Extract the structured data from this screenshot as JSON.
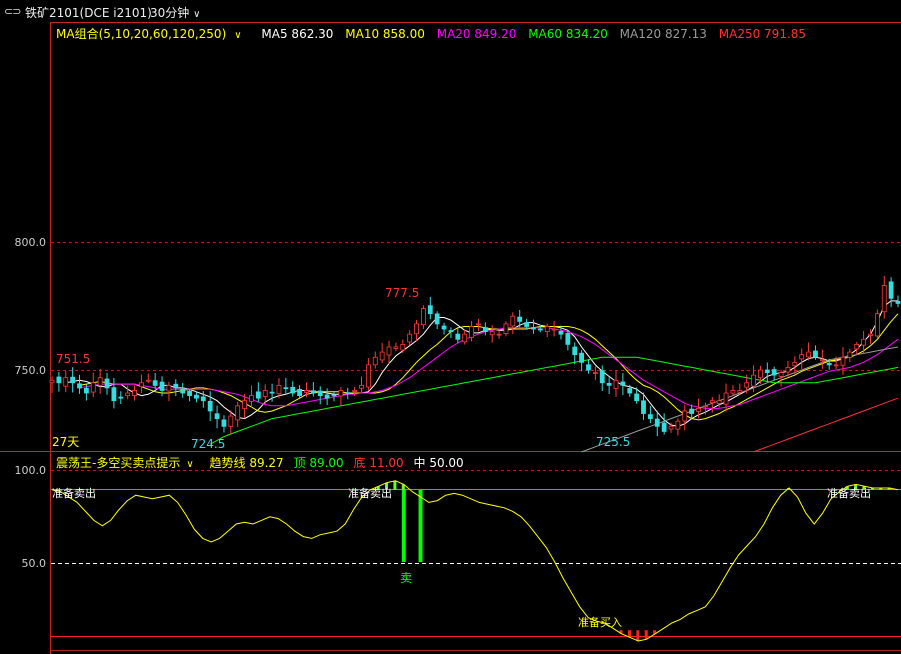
{
  "header": {
    "symbol": "铁矿2101(DCE i2101)",
    "period": "30分钟",
    "icon": "link-icon",
    "dropdown_icon": "chevron-down-icon"
  },
  "ma_legend": {
    "group_label": "MA组合(5,10,20,60,120,250)",
    "items": [
      {
        "label": "MA5 862.30",
        "color": "#ffffff"
      },
      {
        "label": "MA10 858.00",
        "color": "#ffff00"
      },
      {
        "label": "MA20 849.20",
        "color": "#ff00ff"
      },
      {
        "label": "MA60 834.20",
        "color": "#00ff00"
      },
      {
        "label": "MA120 827.13",
        "color": "#9a9a9a"
      },
      {
        "label": "MA250 791.85",
        "color": "#ff3333"
      }
    ]
  },
  "osc_legend": {
    "name": "震荡王-多空买卖点提示",
    "items": [
      {
        "label": "趋势线 89.27",
        "color": "#ffff00"
      },
      {
        "label": "顶 89.00",
        "color": "#00ff00"
      },
      {
        "label": "底 11.00",
        "color": "#ff3333"
      },
      {
        "label": "中 50.00",
        "color": "#ffffff"
      }
    ]
  },
  "chart_data": [
    {
      "type": "candlestick",
      "y_ticks": [
        "800.0",
        "750.0"
      ],
      "ylim": [
        718,
        856
      ],
      "annotations": [
        {
          "text": "751.5",
          "color": "#ff3333"
        },
        {
          "text": "724.5",
          "color": "#33dddd"
        },
        {
          "text": "777.5",
          "color": "#ff3333"
        },
        {
          "text": "725.5",
          "color": "#33dddd"
        },
        {
          "text": "27天",
          "color": "#ffff00"
        }
      ],
      "close": [
        746,
        745,
        747,
        745,
        743,
        741,
        745,
        747,
        743,
        738,
        739,
        741,
        742,
        745,
        746,
        744,
        742,
        744,
        743,
        741,
        740,
        739,
        738,
        734,
        731,
        728,
        732,
        736,
        738,
        740,
        739,
        742,
        741,
        744,
        743,
        741,
        740,
        742,
        741,
        740,
        739,
        740,
        742,
        741,
        742,
        744,
        752,
        755,
        757,
        759,
        759,
        760,
        764,
        768,
        774,
        772,
        768,
        766,
        765,
        762,
        764,
        767,
        768,
        765,
        765,
        764,
        768,
        771,
        769,
        767,
        766,
        766,
        767,
        766,
        764,
        760,
        756,
        753,
        750,
        749,
        745,
        744,
        746,
        744,
        741,
        738,
        733,
        731,
        728,
        726,
        728,
        730,
        734,
        733,
        735,
        736,
        738,
        738,
        741,
        742,
        742,
        745,
        748,
        750,
        749,
        748,
        749,
        751,
        753,
        756,
        757,
        755,
        754,
        752,
        752,
        755,
        757,
        760,
        762,
        764,
        772,
        783,
        778,
        776
      ],
      "ma_series": [
        {
          "name": "MA5",
          "color": "#ffffff",
          "values": [
            745,
            745.5,
            746,
            745.5,
            744.5,
            743.5,
            743.5,
            744.5,
            744.5,
            742.5,
            741,
            740,
            740.5,
            742,
            744,
            744,
            743,
            743,
            742.5,
            741.5,
            740.5,
            739.5,
            738,
            735.5,
            733.5,
            731.5,
            731,
            732.5,
            734.5,
            737.5,
            739,
            740,
            740.5,
            741.5,
            742,
            742,
            741.5,
            741.5,
            741,
            740.5,
            740.5,
            740.5,
            741,
            741,
            741.5,
            744.5,
            749,
            752.5,
            755.5,
            757.5,
            759.5,
            761.5,
            764,
            767.5,
            770.5,
            770.5,
            769.5,
            767.5,
            765.5,
            764.5,
            764.5,
            765.5,
            766,
            765.5,
            765.5,
            766,
            767.5,
            768.5,
            768.5,
            767.5,
            767,
            767,
            766.5,
            765.5,
            763,
            759,
            755.5,
            752,
            749.5,
            747.5,
            745.5,
            744,
            743.5,
            742.5,
            740.5,
            737,
            733.5,
            730.5,
            728.5,
            728,
            729,
            731,
            732.5,
            733.5,
            735,
            736.5,
            737.5,
            739,
            740.5,
            742,
            743.5,
            745.5,
            747.5,
            748.5,
            749,
            749.5,
            751,
            753,
            754.5,
            755,
            754.5,
            753.5,
            753.5,
            754.5,
            756,
            758,
            761,
            764,
            769,
            775,
            777,
            777
          ]
        },
        {
          "name": "MA10",
          "color": "#ffff00",
          "values": [
            744,
            744.5,
            745,
            745.5,
            745,
            744.5,
            744.5,
            744.5,
            744.5,
            743.5,
            742.5,
            741.5,
            741,
            741,
            741.5,
            742,
            742.5,
            743,
            743,
            742.5,
            742,
            741,
            740,
            738.5,
            737,
            735.5,
            734,
            733.5,
            734,
            735,
            736,
            737.5,
            739,
            740.5,
            741,
            741.5,
            741.5,
            741.5,
            741.5,
            741,
            741,
            741,
            741,
            741,
            741.5,
            742.5,
            744.5,
            747,
            750,
            753,
            755.5,
            758,
            760,
            762.5,
            765,
            766.5,
            767,
            767,
            767,
            766.5,
            766,
            766,
            766,
            766,
            766,
            766,
            766.5,
            767,
            767,
            767,
            767,
            767,
            766.5,
            765.5,
            764,
            762,
            759.5,
            757,
            754.5,
            751.5,
            748.5,
            746,
            744,
            743,
            741.5,
            739.5,
            737,
            734.5,
            732.5,
            731,
            730.5,
            731,
            732,
            733,
            734.5,
            735.5,
            737,
            738.5,
            740,
            741.5,
            743,
            744.5,
            746,
            747,
            748,
            749.5,
            750.5,
            751.5,
            752.5,
            753.5,
            754,
            754.5,
            755,
            756,
            757.5,
            759.5,
            762,
            765.5,
            769,
            772
          ]
        },
        {
          "name": "MA20",
          "color": "#ff00ff",
          "values": [
            743,
            743.5,
            744,
            744.5,
            744.5,
            744.5,
            744.5,
            744.5,
            744.5,
            744,
            743.5,
            743,
            742.5,
            742.5,
            742.5,
            742.5,
            742.5,
            742.5,
            742.5,
            742.5,
            742,
            741.5,
            741,
            740.5,
            739.5,
            738.5,
            737.5,
            736.5,
            736,
            736,
            736,
            736.5,
            737,
            737.5,
            738,
            738.5,
            739,
            739.5,
            740,
            740.5,
            740.5,
            741,
            741,
            741.5,
            742,
            743,
            744,
            745.5,
            747,
            749,
            751,
            753,
            755,
            757,
            759,
            760.5,
            762,
            763,
            764,
            765,
            765.5,
            766,
            766.5,
            766.5,
            766.5,
            766.5,
            766.5,
            766.5,
            766.5,
            766,
            765.5,
            765,
            764,
            763,
            761.5,
            760,
            758,
            756,
            754,
            752,
            750,
            748,
            746,
            744.5,
            743,
            741.5,
            740,
            738.5,
            737,
            736,
            735.5,
            735,
            735,
            735,
            735.5,
            736,
            736.5,
            737.5,
            738.5,
            739.5,
            740.5,
            741.5,
            742.5,
            743.5,
            744.5,
            745.5,
            746.5,
            747.5,
            748.5,
            749.5,
            750,
            750.5,
            751,
            752,
            753,
            754.5,
            756,
            758,
            760,
            762
          ]
        },
        {
          "name": "MA60",
          "color": "#00ff00",
          "values": [
            721,
            722.5,
            724,
            725,
            726,
            727,
            728,
            729,
            730,
            731,
            731.5,
            732,
            732.5,
            733,
            733.5,
            734,
            734.5,
            735,
            735.5,
            736,
            736.5,
            737,
            737.5,
            738,
            738.5,
            739,
            739.5,
            740,
            740.5,
            741,
            741.5,
            742,
            742.5,
            743,
            743.5,
            744,
            744.5,
            745,
            745.5,
            746,
            746.5,
            747,
            747.5,
            748,
            748.5,
            749,
            749.5,
            750,
            750.5,
            751,
            751.5,
            752,
            752.5,
            753,
            753.5,
            754,
            754.5,
            755,
            755,
            755,
            755,
            755,
            755,
            754.5,
            754,
            753.5,
            753,
            752.5,
            752,
            751.5,
            751,
            750.5,
            750,
            749.5,
            749,
            748.5,
            748,
            747.5,
            747,
            746.5,
            746,
            745.5,
            745,
            745,
            745,
            745,
            745,
            745,
            745,
            745.5,
            746,
            746.5,
            747,
            747.5,
            748,
            748.5,
            749,
            749.5,
            750,
            750.5,
            751
          ]
        },
        {
          "name": "MA120",
          "color": "#9a9a9a",
          "values": [
            718,
            719,
            720,
            721,
            722,
            723,
            724,
            725,
            726,
            727,
            728,
            729,
            730,
            731,
            732,
            733,
            734,
            735,
            736,
            737,
            738,
            739,
            740,
            741,
            742,
            743,
            744,
            745,
            746,
            747,
            748,
            749,
            750,
            751,
            752,
            753,
            754,
            754.5,
            755,
            755.5,
            756,
            756.5,
            757,
            757.5,
            758,
            758.5,
            759
          ]
        },
        {
          "name": "MA250",
          "color": "#ff3333",
          "values": [
            718,
            719,
            720,
            721,
            722,
            723,
            724,
            725,
            726,
            727,
            728,
            729,
            730,
            731,
            732,
            733,
            734,
            735,
            736,
            737,
            738,
            739
          ]
        }
      ]
    },
    {
      "type": "line",
      "y_ticks": [
        "100.0",
        "50.0"
      ],
      "ylim": [
        0,
        100
      ],
      "top_line": 89,
      "bottom_line": 11,
      "mid_line": 50,
      "annotations": [
        {
          "text": "准备卖出",
          "color": "#ffffff"
        },
        {
          "text": "准备卖出",
          "color": "#ffffff"
        },
        {
          "text": "卖",
          "color": "#00ff00"
        },
        {
          "text": "准备买入",
          "color": "#ffff00"
        },
        {
          "text": "准备卖出",
          "color": "#ffffff"
        }
      ],
      "trend": [
        89,
        88,
        85,
        82,
        77,
        72,
        69,
        72,
        78,
        83,
        86,
        85,
        84,
        85,
        86,
        82,
        75,
        67,
        62,
        60,
        62,
        66,
        70,
        71,
        70,
        72,
        74,
        73,
        70,
        66,
        63,
        62,
        64,
        65,
        66,
        70,
        78,
        85,
        89,
        91,
        93,
        94,
        92,
        88,
        85,
        82,
        83,
        86,
        87,
        86,
        84,
        82,
        81,
        80,
        79,
        77,
        74,
        69,
        63,
        57,
        49,
        40,
        32,
        24,
        18,
        16,
        15,
        12,
        9,
        7,
        5,
        6,
        9,
        12,
        15,
        17,
        20,
        22,
        24,
        30,
        38,
        46,
        53,
        58,
        63,
        70,
        79,
        86,
        90,
        85,
        76,
        70,
        76,
        84,
        88,
        91,
        92,
        91,
        90,
        90,
        90,
        89
      ]
    }
  ]
}
